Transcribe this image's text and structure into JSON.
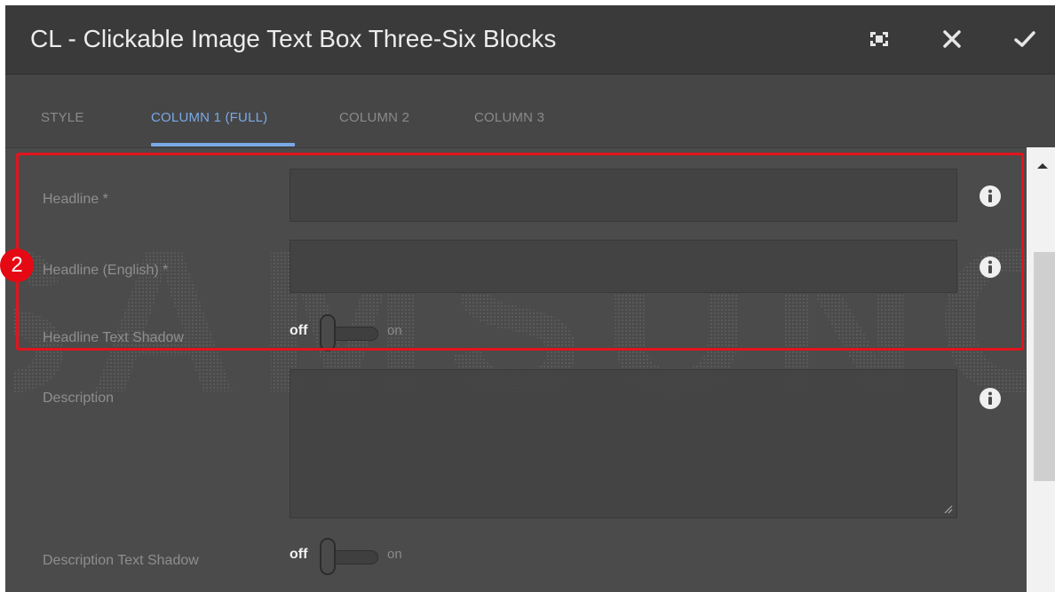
{
  "dialog": {
    "title": "CL - Clickable Image Text Box Three-Six Blocks",
    "icons": {
      "fullscreen": "fullscreen-icon",
      "close": "close-icon",
      "confirm": "check-icon"
    }
  },
  "tabs": [
    {
      "label": "STYLE",
      "active": false
    },
    {
      "label": "COLUMN 1 (FULL)",
      "active": true
    },
    {
      "label": "COLUMN 2",
      "active": false
    },
    {
      "label": "COLUMN 3",
      "active": false
    }
  ],
  "fields": {
    "headline": {
      "label": "Headline *",
      "value": ""
    },
    "headline_english": {
      "label": "Headline (English) *",
      "value": ""
    },
    "headline_shadow": {
      "label": "Headline Text Shadow",
      "off_label": "off",
      "on_label": "on"
    },
    "description": {
      "label": "Description",
      "value": ""
    },
    "description_shadow": {
      "label": "Description Text Shadow",
      "off_label": "off",
      "on_label": "on"
    }
  },
  "annotation": {
    "badge_number": "2",
    "color": "#e1141c"
  },
  "watermark": {
    "text": "SAMSUNG"
  },
  "colors": {
    "accent": "#79a9e6",
    "background": "#4b4b4b",
    "titlebar": "#3a3a3a"
  }
}
